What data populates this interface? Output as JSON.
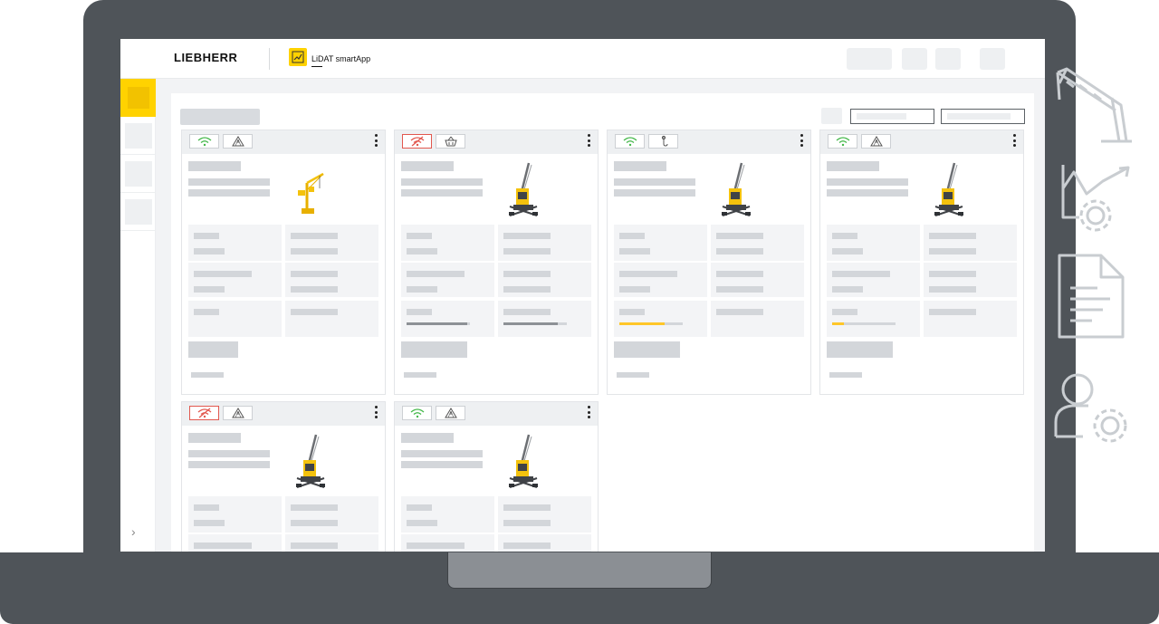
{
  "header": {
    "brand": "LIEBHERR",
    "app_name": "LiDAT smartApp"
  },
  "sidebar": {
    "expand_icon": "chevron-right-icon",
    "expand_glyph": "›"
  },
  "colors": {
    "brand_yellow": "#ffd200",
    "frame_gray": "#4f5459",
    "signal_ok": "#44b84a",
    "signal_lost": "#e2584f",
    "progress_fill": "#ffc629",
    "progress_neutral": "#8d9196"
  },
  "cards": [
    {
      "signal": "ok",
      "status_icon": "warning-icon",
      "machine": "tower-crane",
      "progress": null
    },
    {
      "signal": "lost",
      "status_icon": "basket-icon",
      "machine": "mobile-harbour-crane",
      "progress": 0.95
    },
    {
      "signal": "ok",
      "status_icon": "hook-icon",
      "machine": "mobile-harbour-crane",
      "progress": 0.72
    },
    {
      "signal": "ok",
      "status_icon": "warning-icon",
      "machine": "mobile-harbour-crane",
      "progress": 0.18
    },
    {
      "signal": "lost",
      "status_icon": "warning-icon",
      "machine": "mobile-harbour-crane",
      "progress": null
    },
    {
      "signal": "ok",
      "status_icon": "warning-icon",
      "machine": "mobile-harbour-crane",
      "progress": null
    }
  ],
  "side_icons": [
    "crane-outline-icon",
    "analytics-gear-icon",
    "document-icon",
    "user-settings-icon"
  ]
}
